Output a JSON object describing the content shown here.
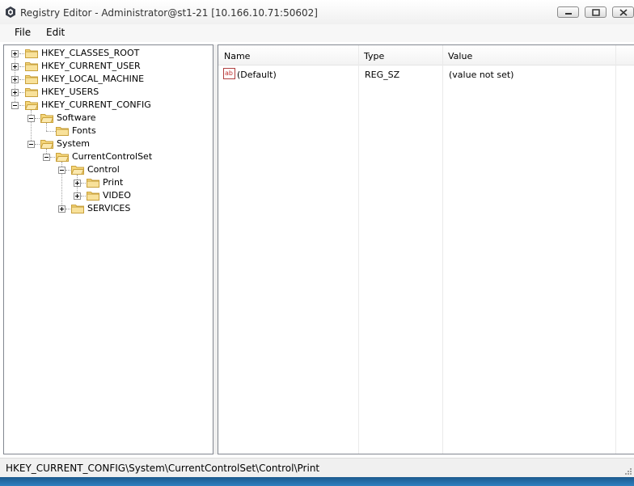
{
  "window": {
    "title": "Registry Editor - Administrator@st1-21 [10.166.10.71:50602]",
    "buttons": [
      "minimize",
      "maximize",
      "close"
    ]
  },
  "menu": {
    "file": "File",
    "edit": "Edit"
  },
  "tree": {
    "nodes": [
      {
        "label": "HKEY_CLASSES_ROOT",
        "expander": "plus"
      },
      {
        "label": "HKEY_CURRENT_USER",
        "expander": "plus"
      },
      {
        "label": "HKEY_LOCAL_MACHINE",
        "expander": "plus"
      },
      {
        "label": "HKEY_USERS",
        "expander": "plus"
      },
      {
        "label": "HKEY_CURRENT_CONFIG",
        "expander": "minus"
      },
      {
        "label": "Software",
        "expander": "minus"
      },
      {
        "label": "Fonts",
        "expander": "none"
      },
      {
        "label": "System",
        "expander": "minus"
      },
      {
        "label": "CurrentControlSet",
        "expander": "minus"
      },
      {
        "label": "Control",
        "expander": "minus"
      },
      {
        "label": "Print",
        "expander": "plus",
        "selected": true
      },
      {
        "label": "VIDEO",
        "expander": "plus"
      },
      {
        "label": "SERVICES",
        "expander": "plus"
      }
    ]
  },
  "list": {
    "columns": [
      "Name",
      "Type",
      "Value"
    ],
    "rows": [
      {
        "name": "(Default)",
        "type": "REG_SZ",
        "value": "(value not set)",
        "icon": "string-value-icon"
      }
    ]
  },
  "status": {
    "path": "HKEY_CURRENT_CONFIG\\System\\CurrentControlSet\\Control\\Print"
  },
  "colors": {
    "folder": "#f5d67a",
    "folder_edge": "#c9a13c",
    "accent_taskbar": "#2f7fbf"
  }
}
